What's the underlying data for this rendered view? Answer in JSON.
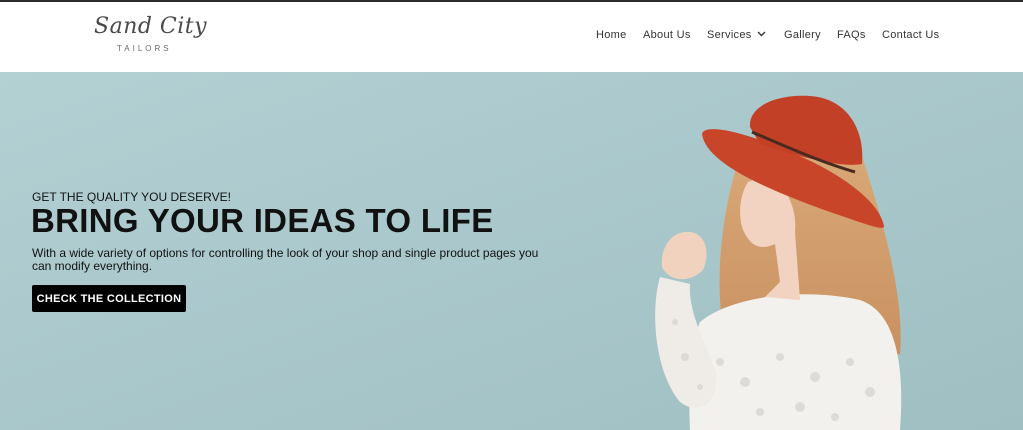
{
  "brand": {
    "logo_script": "Sand City",
    "logo_sub": "TAILORS"
  },
  "nav": {
    "items": [
      {
        "label": "Home"
      },
      {
        "label": "About Us"
      },
      {
        "label": "Services"
      },
      {
        "label": "Gallery"
      },
      {
        "label": "FAQs"
      },
      {
        "label": "Contact Us"
      }
    ],
    "dropdown_icon": "chevron-down-icon"
  },
  "hero": {
    "eyebrow": "GET THE QUALITY YOU DESERVE!",
    "headline": "BRING YOUR IDEAS TO LIFE",
    "description": "With a wide variety of options for controlling the look of your shop and single product pages you can modify everything.",
    "cta_label": "CHECK THE COLLECTION",
    "colors": {
      "background": "#a9c8cc",
      "hat": "#c8452a",
      "cta": "#000000"
    }
  }
}
